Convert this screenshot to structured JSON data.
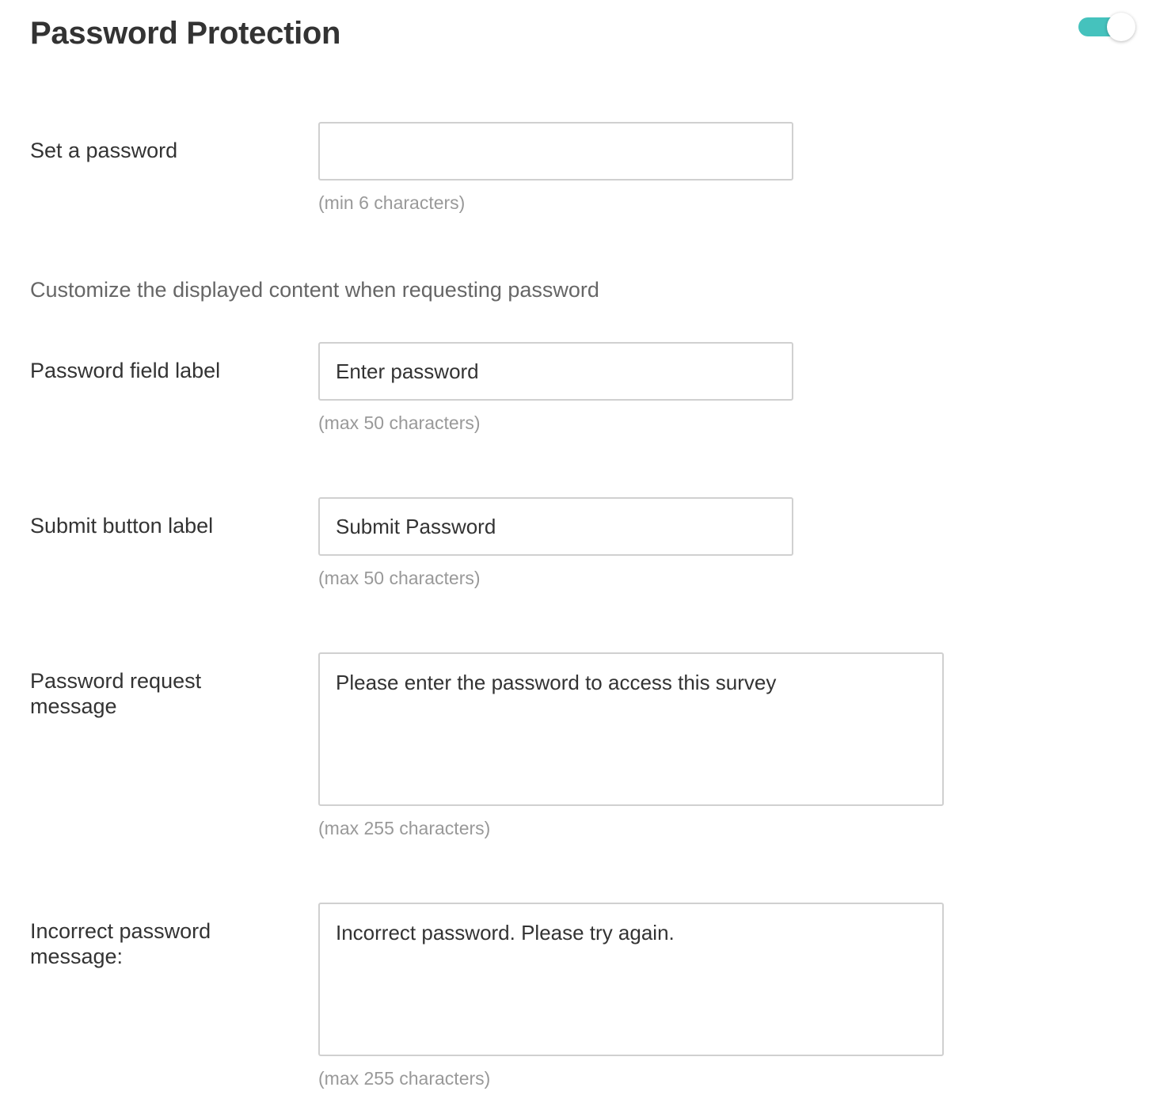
{
  "header": {
    "title": "Password Protection",
    "toggle": {
      "enabled": true,
      "color": "#45c2bd"
    }
  },
  "set_password": {
    "label": "Set a password",
    "value": "",
    "placeholder": "",
    "hint": "(min 6 characters)"
  },
  "customize_heading": "Customize the displayed content when requesting password",
  "fields": {
    "field_label": {
      "label": "Password field label",
      "value": "Enter password",
      "hint": "(max 50 characters)"
    },
    "submit_label": {
      "label": "Submit button label",
      "value": "Submit Password",
      "hint": "(max 50 characters)"
    },
    "request_message": {
      "label": "Password request message",
      "value": "Please enter the password to access this survey",
      "hint": "(max 255 characters)"
    },
    "incorrect_message": {
      "label": "Incorrect password message:",
      "value": "Incorrect password. Please try again.",
      "hint": "(max 255 characters)"
    }
  }
}
